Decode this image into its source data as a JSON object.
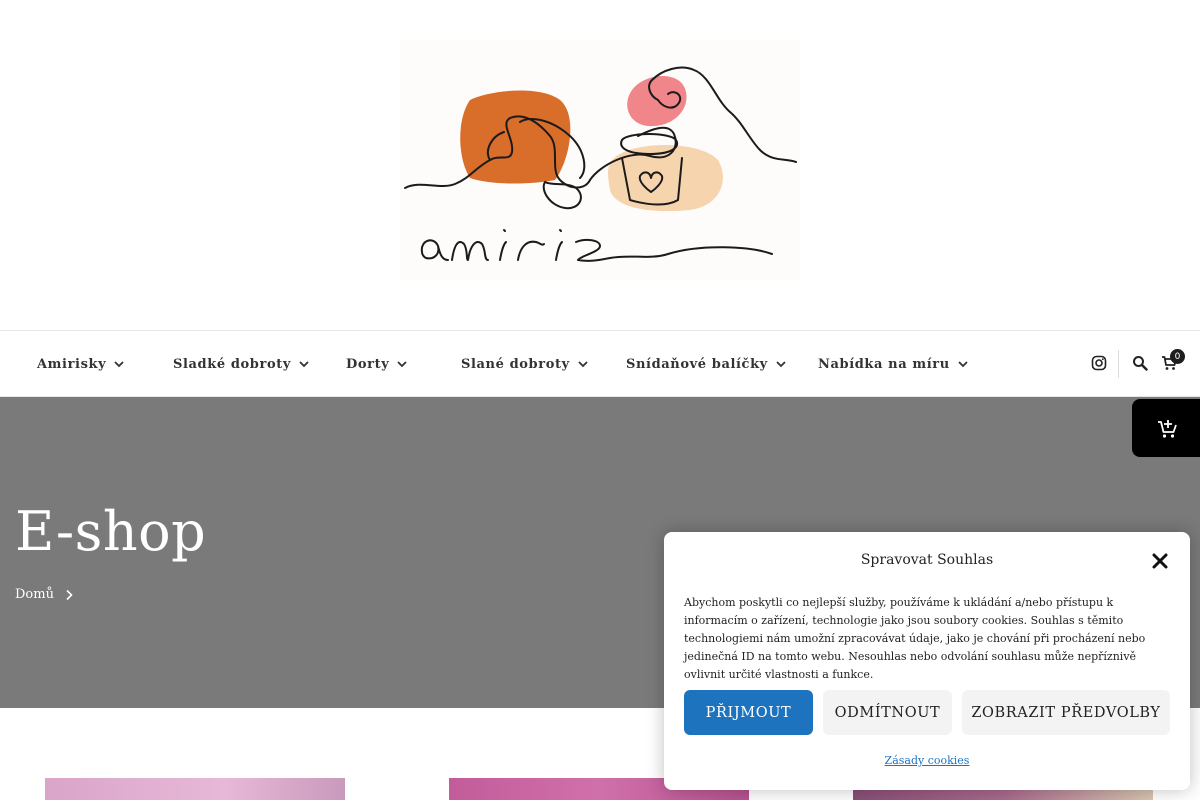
{
  "logo": {
    "brand_text": "amiris"
  },
  "nav": {
    "items": [
      {
        "label": "Amirisky"
      },
      {
        "label": "Sladké dobroty"
      },
      {
        "label": "Dorty"
      },
      {
        "label": "Slané dobroty"
      },
      {
        "label": "Snídaňové balíčky"
      },
      {
        "label": "Nabídka na míru"
      }
    ],
    "icons": [
      "instagram-icon",
      "search-icon",
      "cart-icon"
    ],
    "cart_count": "0"
  },
  "hero": {
    "title": "E-shop",
    "breadcrumb": [
      "Domů"
    ]
  },
  "floating_cart": {
    "icon": "add-to-cart-icon"
  },
  "cookie": {
    "title": "Spravovat Souhlas",
    "text": "Abychom poskytli co nejlepší služby, používáme k ukládání a/nebo přístupu k informacím o zařízení, technologie jako jsou soubory cookies. Souhlas s těmito technologiemi nám umožní zpracovávat údaje, jako je chování při procházení nebo jedinečná ID na tomto webu. Nesouhlas nebo odvolání souhlasu může nepříznivě ovlivnit určité vlastnosti a funkce.",
    "accept_label": "PŘIJMOUT",
    "deny_label": "ODMÍTNOUT",
    "prefs_label": "ZOBRAZIT PŘEDVOLBY",
    "policy_link": "Zásady cookies"
  },
  "colors": {
    "accent_blue": "#1e73be",
    "hero_gray": "#7a7a7a",
    "logo_orange": "#d96d2a",
    "logo_pink": "#f0858a",
    "logo_peach": "#f6d4ae"
  }
}
